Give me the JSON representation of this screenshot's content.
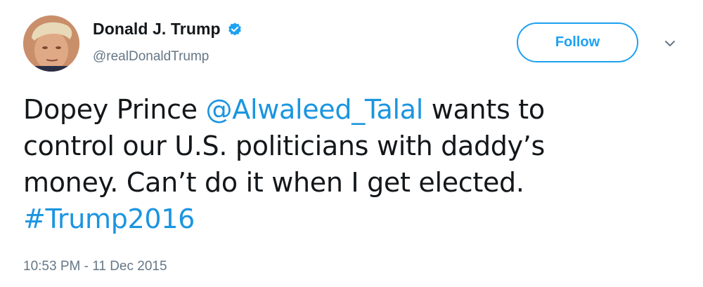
{
  "author": {
    "display_name": "Donald J. Trump",
    "handle": "@realDonaldTrump",
    "verified": true,
    "avatar_icon": "profile-photo"
  },
  "actions": {
    "follow_label": "Follow",
    "more_icon": "chevron-down-icon"
  },
  "tweet": {
    "line1_text_a": "Dopey Prince ",
    "line1_mention": "@Alwaleed_Talal",
    "line1_text_b": " wants to",
    "line2": "control our U.S. politicians with daddy’s",
    "line3": "money. Can’t do it when I get elected.",
    "hashtag": "#Trump2016"
  },
  "timestamp": "10:53 PM - 11 Dec 2015",
  "colors": {
    "accent": "#1da1f2",
    "link": "#1b95e0",
    "secondary_text": "#657786",
    "primary_text": "#14171a"
  }
}
